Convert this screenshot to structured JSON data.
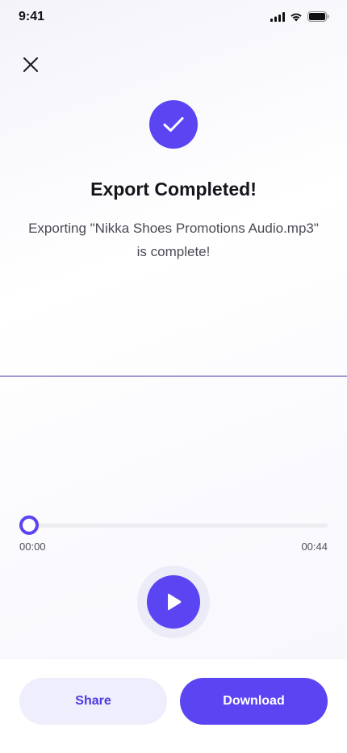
{
  "status_bar": {
    "time": "9:41"
  },
  "header": {
    "close_icon": "close-icon"
  },
  "hero": {
    "icon": "check-icon",
    "title": "Export Completed!",
    "subtitle_line1": "Exporting \"Nikka Shoes Promotions Audio.mp3\"",
    "subtitle_line2": "is complete!"
  },
  "player": {
    "current_time": "00:00",
    "total_time": "00:44",
    "progress": 0,
    "play_icon": "play-icon"
  },
  "actions": {
    "share_label": "Share",
    "download_label": "Download"
  },
  "colors": {
    "accent": "#5b45f2",
    "accent_soft": "#efeefc",
    "divider": "#4a2fa8"
  }
}
